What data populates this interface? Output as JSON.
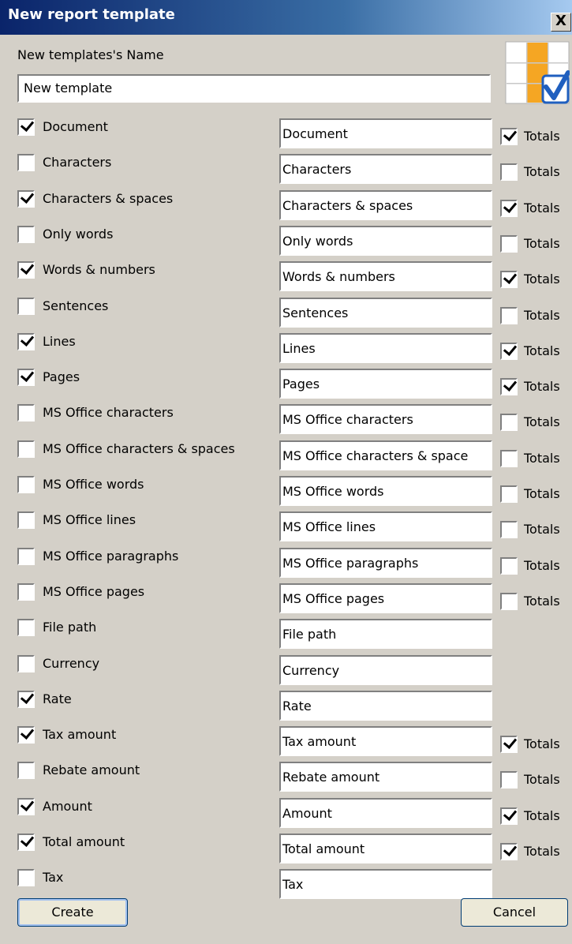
{
  "window": {
    "title": "New report template",
    "close_symbol": "X"
  },
  "name_section": {
    "label": "New templates's Name",
    "value": "New template"
  },
  "totals_label": "Totals",
  "rows": [
    {
      "label": "Document",
      "checked": true,
      "field": "Document",
      "has_totals": true,
      "totals_checked": true
    },
    {
      "label": "Characters",
      "checked": false,
      "field": "Characters",
      "has_totals": true,
      "totals_checked": false
    },
    {
      "label": "Characters & spaces",
      "checked": true,
      "field": "Characters & spaces",
      "has_totals": true,
      "totals_checked": true
    },
    {
      "label": "Only words",
      "checked": false,
      "field": "Only words",
      "has_totals": true,
      "totals_checked": false
    },
    {
      "label": "Words & numbers",
      "checked": true,
      "field": "Words & numbers",
      "has_totals": true,
      "totals_checked": true
    },
    {
      "label": "Sentences",
      "checked": false,
      "field": "Sentences",
      "has_totals": true,
      "totals_checked": false
    },
    {
      "label": "Lines",
      "checked": true,
      "field": "Lines",
      "has_totals": true,
      "totals_checked": true
    },
    {
      "label": "Pages",
      "checked": true,
      "field": "Pages",
      "has_totals": true,
      "totals_checked": true
    },
    {
      "label": "MS Office characters",
      "checked": false,
      "field": "MS Office characters",
      "has_totals": true,
      "totals_checked": false
    },
    {
      "label": "MS Office characters & spaces",
      "checked": false,
      "field": "MS Office characters & space",
      "has_totals": true,
      "totals_checked": false
    },
    {
      "label": "MS Office words",
      "checked": false,
      "field": "MS Office words",
      "has_totals": true,
      "totals_checked": false
    },
    {
      "label": "MS Office lines",
      "checked": false,
      "field": "MS Office lines",
      "has_totals": true,
      "totals_checked": false
    },
    {
      "label": "MS Office paragraphs",
      "checked": false,
      "field": "MS Office paragraphs",
      "has_totals": true,
      "totals_checked": false
    },
    {
      "label": "MS Office pages",
      "checked": false,
      "field": "MS Office pages",
      "has_totals": true,
      "totals_checked": false
    },
    {
      "label": "File path",
      "checked": false,
      "field": "File path",
      "has_totals": false,
      "totals_checked": false
    },
    {
      "label": "Currency",
      "checked": false,
      "field": "Currency",
      "has_totals": false,
      "totals_checked": false
    },
    {
      "label": "Rate",
      "checked": true,
      "field": "Rate",
      "has_totals": false,
      "totals_checked": false
    },
    {
      "label": "Tax amount",
      "checked": true,
      "field": "Tax amount",
      "has_totals": true,
      "totals_checked": true
    },
    {
      "label": "Rebate amount",
      "checked": false,
      "field": "Rebate amount",
      "has_totals": true,
      "totals_checked": false
    },
    {
      "label": "Amount",
      "checked": true,
      "field": "Amount",
      "has_totals": true,
      "totals_checked": true
    },
    {
      "label": "Total amount",
      "checked": true,
      "field": "Total amount",
      "has_totals": true,
      "totals_checked": true
    },
    {
      "label": "Tax",
      "checked": false,
      "field": "Tax",
      "has_totals": false,
      "totals_checked": false
    }
  ],
  "buttons": {
    "create": "Create",
    "cancel": "Cancel"
  },
  "colors": {
    "titlebar_start": "#0a246a",
    "titlebar_end": "#a6caf0",
    "dialog_bg": "#d4d0c8",
    "logo_orange": "#f5a623",
    "logo_blue": "#1f5fbf"
  }
}
